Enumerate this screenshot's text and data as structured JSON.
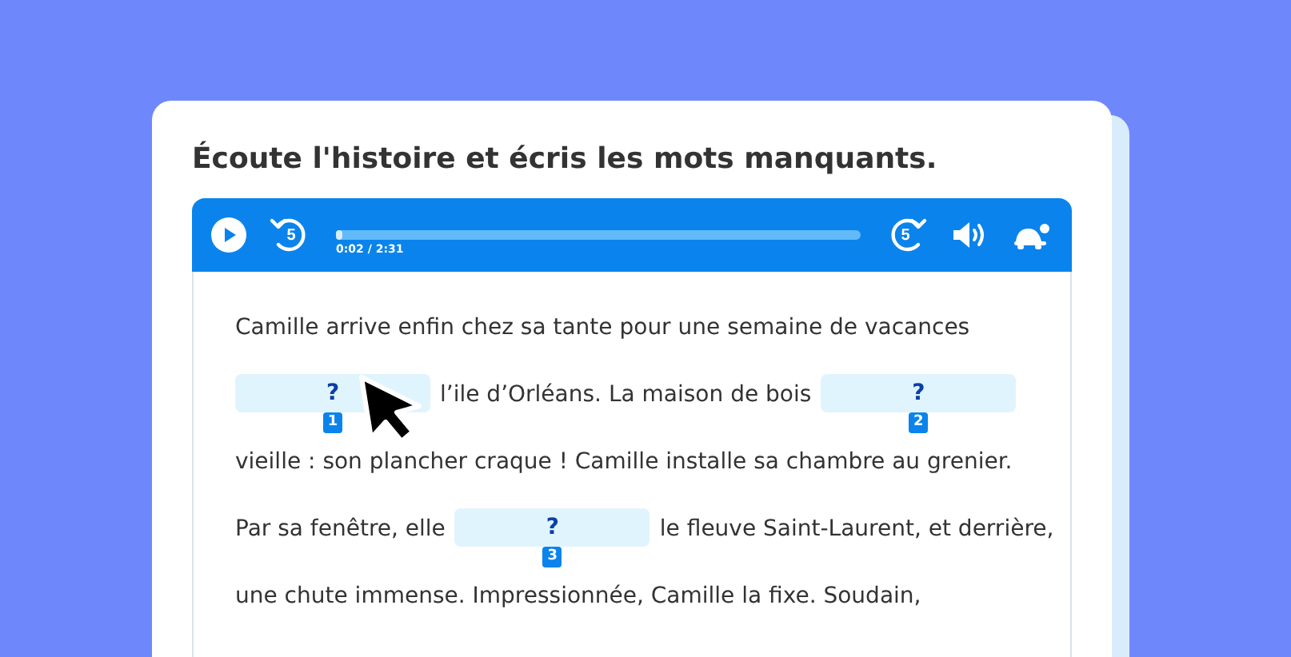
{
  "title": "Écoute l'histoire et écris les mots manquants.",
  "player": {
    "playing": false,
    "rewind": "5",
    "forward": "5",
    "level": 0.01,
    "time": "0:02 / 2:31"
  },
  "story": [
    {
      "segments": [
        {
          "kind": "text",
          "text": "Camille arrive enfin chez sa tante pour une semaine de vacances"
        }
      ]
    },
    {
      "segments": [
        {
          "kind": "blank",
          "mark": "?",
          "number": "1"
        },
        {
          "kind": "text",
          "text": "l’ile d’Orléans. La maison de bois"
        },
        {
          "kind": "blank",
          "mark": "?",
          "number": "2"
        }
      ]
    },
    {
      "segments": [
        {
          "kind": "text",
          "text": "vieille : son plancher craque ! Camille installe sa chambre au grenier."
        }
      ]
    },
    {
      "segments": [
        {
          "kind": "text",
          "text": "Par sa fenêtre, elle"
        },
        {
          "kind": "blank",
          "mark": "?",
          "number": "3"
        },
        {
          "kind": "text",
          "text": "le fleuve Saint-Laurent, et derrière,"
        }
      ]
    },
    {
      "segments": [
        {
          "kind": "text",
          "text": "une chute immense. Impressionnée, Camille la fixe. Soudain,"
        }
      ]
    }
  ]
}
